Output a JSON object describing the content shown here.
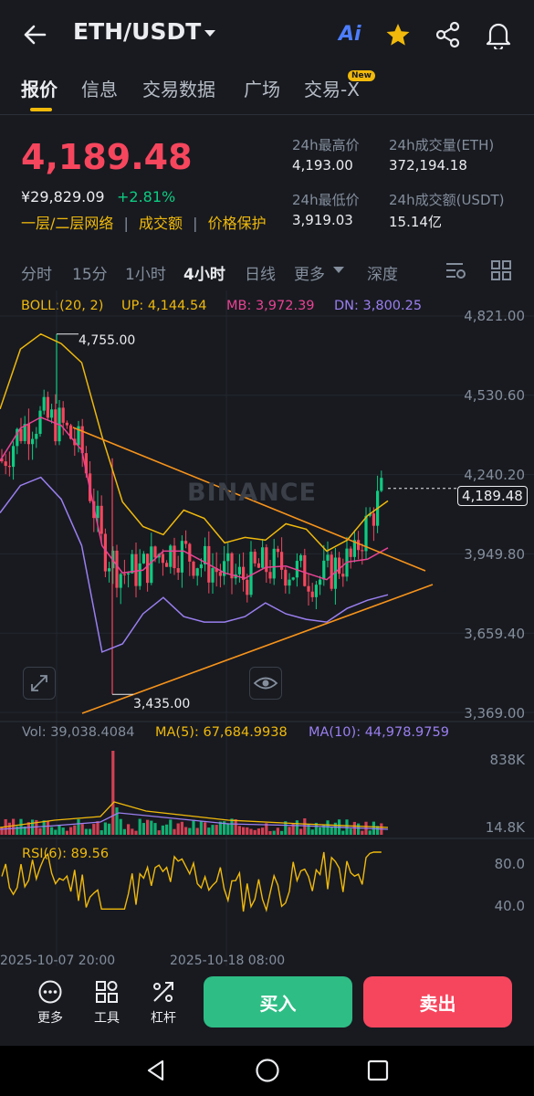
{
  "header": {
    "pair": "ETH/USDT",
    "ai_label": "Ai"
  },
  "tabs": [
    {
      "label": "报价"
    },
    {
      "label": "信息"
    },
    {
      "label": "交易数据"
    },
    {
      "label": "广场"
    },
    {
      "label": "交易-X"
    }
  ],
  "new_badge": "New",
  "ticker": {
    "price": "4,189.48",
    "cny": "¥29,829.09",
    "change": "+2.81%",
    "links": [
      "一层/二层网络",
      "成交额",
      "价格保护"
    ],
    "high_label": "24h最高价",
    "high_value": "4,193.00",
    "low_label": "24h最低价",
    "low_value": "3,919.03",
    "vol_eth_label": "24h成交量(ETH)",
    "vol_eth_value": "372,194.18",
    "vol_usdt_label": "24h成交额(USDT)",
    "vol_usdt_value": "15.14亿"
  },
  "intervals": [
    {
      "label": "分时"
    },
    {
      "label": "15分"
    },
    {
      "label": "1小时"
    },
    {
      "label": "4小时"
    },
    {
      "label": "日线"
    },
    {
      "label": "更多"
    },
    {
      "label": "深度"
    }
  ],
  "boll": {
    "label": "BOLL:(20, 2)",
    "up": "UP: 4,144.54",
    "mb": "MB: 3,972.39",
    "dn": "DN: 3,800.25"
  },
  "price_axis": [
    "4,821.00",
    "4,530.60",
    "4,240.20",
    "3,949.80",
    "3,659.40",
    "3,369.00"
  ],
  "current_price_tag": "4,189.48",
  "annotations": {
    "high": "4,755.00",
    "low": "3,435.00"
  },
  "watermark": "BINANCE",
  "volume": {
    "vol": "Vol: 39,038.4084",
    "ma5": "MA(5): 67,684.9938",
    "ma10": "MA(10): 44,978.9759",
    "axis_top": "838K",
    "axis_bottom": "14.8K"
  },
  "rsi": {
    "label": "RSI(6): 89.56",
    "axis_top": "80.0",
    "axis_bottom": "40.0"
  },
  "time_axis": [
    "2025-10-07 20:00",
    "2025-10-18 08:00"
  ],
  "bottom": {
    "more": "更多",
    "tools": "工具",
    "leverage": "杠杆",
    "buy": "买入",
    "sell": "卖出"
  },
  "colors": {
    "up": "#0ecb81",
    "down": "#f6465d",
    "accent": "#f0b90b",
    "mb": "#e84393",
    "dn": "#9b7ff0",
    "trendline": "#f7931a"
  },
  "chart_data": {
    "type": "line",
    "title": "",
    "series": [
      {
        "name": "UP",
        "values": [
          4480,
          4700,
          4755,
          4720,
          4650,
          4380,
          4140,
          4050,
          4020,
          4110,
          4080,
          3990,
          4010,
          4000,
          4060,
          4040,
          3960,
          4000,
          4090,
          4144
        ]
      },
      {
        "name": "MB",
        "values": [
          4290,
          4410,
          4450,
          4420,
          4330,
          3980,
          3880,
          3890,
          3960,
          3960,
          3920,
          3880,
          3860,
          3900,
          3905,
          3880,
          3855,
          3920,
          3930,
          3972
        ]
      },
      {
        "name": "DN",
        "values": [
          4100,
          4200,
          4230,
          4150,
          3980,
          3590,
          3620,
          3730,
          3790,
          3720,
          3700,
          3700,
          3720,
          3770,
          3730,
          3710,
          3700,
          3750,
          3780,
          3800
        ]
      }
    ],
    "ylim": [
      3369,
      4821
    ],
    "price_range": {
      "high": 4755,
      "low": 3435,
      "last": 4189.48
    }
  }
}
